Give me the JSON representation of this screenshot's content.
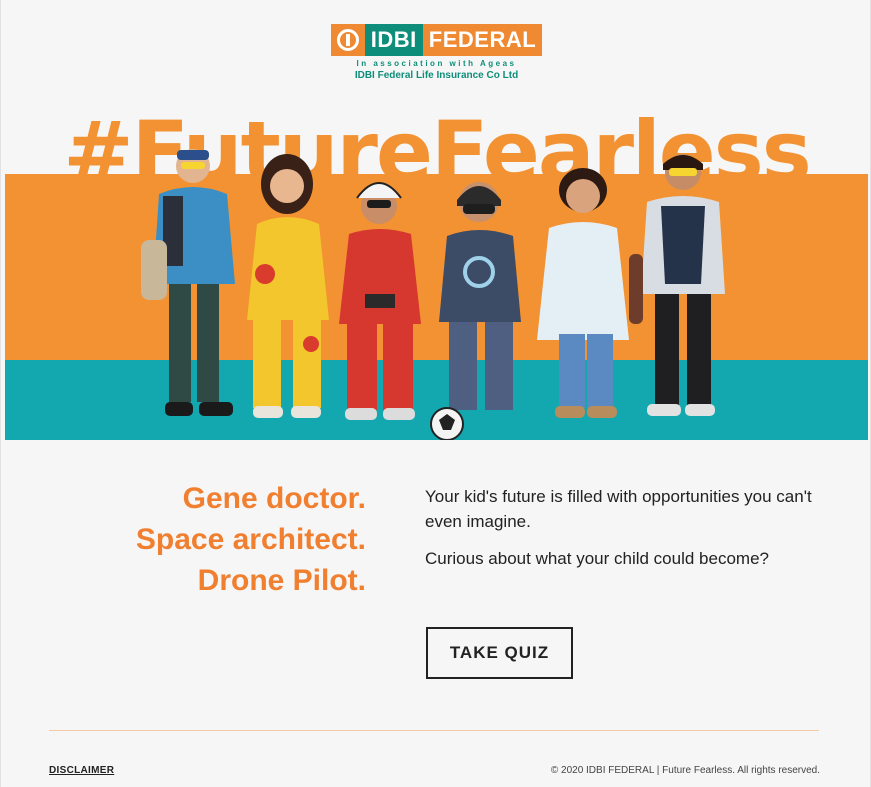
{
  "logo": {
    "idbi": "IDBI",
    "federal": "FEDERAL",
    "association": "In association with Ageas",
    "company": "IDBI Federal Life Insurance Co Ltd",
    "colors": {
      "teal": "#0e8e7a",
      "orange": "#f08a32"
    }
  },
  "banner": {
    "hashtag": "#FutureFearless",
    "colors": {
      "orange": "#f39232",
      "teal": "#13a7b0"
    }
  },
  "headline": {
    "line1": "Gene doctor.",
    "line2": "Space architect.",
    "line3": "Drone Pilot."
  },
  "body": {
    "para1": "Your kid's future is filled with opportunities you can't even imagine.",
    "para2": "Curious about what your child could become?"
  },
  "cta": {
    "label": "TAKE QUIZ"
  },
  "footer": {
    "disclaimer": "DISCLAIMER",
    "copyright": "© 2020 IDBI FEDERAL | Future Fearless. All rights reserved."
  }
}
